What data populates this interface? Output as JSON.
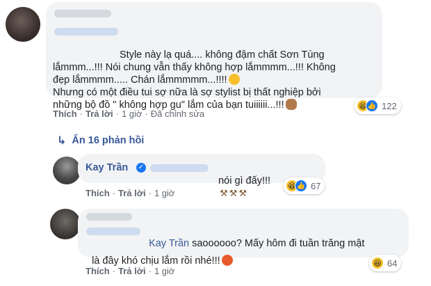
{
  "comments": [
    {
      "text_line1": "Style này lạ quá.... không đậm chất Sơn Tùng",
      "text_rest": "lắmmm...!!! Nói chung vẫn thấy không hợp lắmmmm...!!! Không\nđẹp lắmmmm..... Chán lắmmmmm...!!!!",
      "text_line4": "Nhưng có một điều tui sợ nữa là sợ stylist bị thất nghiệp bởi\nnhững bộ đồ \" không hợp gu\" lắm của bạn tuiiiiii...!!!",
      "actions": {
        "like": "Thích",
        "reply": "Trả lời",
        "time": "1 giờ",
        "edited": "Đã chỉnh sửa"
      },
      "reaction_count": "122"
    }
  ],
  "replies_toggle": "Ẩn 16 phản hồi",
  "reply1": {
    "author": "Kay Trần",
    "text": "nói gì đấy!!!",
    "actions": {
      "like": "Thích",
      "reply": "Trả lời",
      "time": "1 giờ"
    },
    "reaction_count": "67"
  },
  "reply2": {
    "tag": "Kay Trần",
    "text_line1": " saoooooo? Mấy hôm đi tuần trăng mật",
    "text_line2": "là đây khó chịu lắm rồi nhé!!!",
    "actions": {
      "like": "Thích",
      "reply": "Trả lời",
      "time": "1 giờ"
    },
    "reaction_count": "64"
  },
  "separators": {
    "dot": "·"
  },
  "icons": {
    "verified": "✓",
    "like": "👍",
    "haha": "😆",
    "arrow": "↳",
    "hammer": "⚒"
  },
  "colors": {
    "link": "#385898",
    "bubble": "#f2f3f5",
    "like_blue": "#1877f2"
  }
}
